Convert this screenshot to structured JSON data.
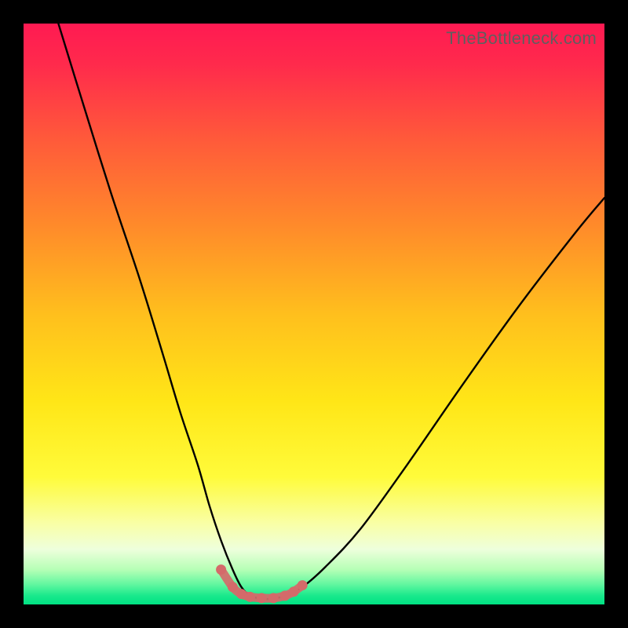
{
  "watermark": "TheBottleneck.com",
  "colors": {
    "frame": "#000000",
    "gradient_stops": [
      {
        "offset": 0.0,
        "color": "#ff1a52"
      },
      {
        "offset": 0.07,
        "color": "#ff2a4c"
      },
      {
        "offset": 0.2,
        "color": "#ff5a3a"
      },
      {
        "offset": 0.35,
        "color": "#ff8b2a"
      },
      {
        "offset": 0.5,
        "color": "#ffbf1d"
      },
      {
        "offset": 0.65,
        "color": "#ffe617"
      },
      {
        "offset": 0.78,
        "color": "#fffb3a"
      },
      {
        "offset": 0.86,
        "color": "#f9ffa5"
      },
      {
        "offset": 0.905,
        "color": "#eeffdc"
      },
      {
        "offset": 0.94,
        "color": "#b6ffb6"
      },
      {
        "offset": 0.965,
        "color": "#63f7a0"
      },
      {
        "offset": 0.985,
        "color": "#19e98c"
      },
      {
        "offset": 1.0,
        "color": "#00e183"
      }
    ],
    "curve": "#000000",
    "marker": "#d46a6a"
  },
  "chart_data": {
    "type": "line",
    "title": "",
    "xlabel": "",
    "ylabel": "",
    "xlim": [
      0,
      100
    ],
    "ylim": [
      0,
      100
    ],
    "grid": false,
    "series": [
      {
        "name": "bottleneck-curve",
        "x": [
          6,
          10,
          15,
          20,
          24,
          27,
          30,
          32,
          34,
          36,
          37.5,
          39,
          41,
          43,
          45,
          48,
          52,
          58,
          66,
          75,
          85,
          95,
          100
        ],
        "values": [
          100,
          87,
          71,
          56,
          43,
          33,
          24,
          17,
          11,
          6,
          3,
          1.5,
          1,
          1,
          1.5,
          3,
          6.5,
          13,
          24,
          37,
          51,
          64,
          70
        ]
      }
    ],
    "markers": {
      "name": "bottom-highlight",
      "x": [
        34,
        36,
        37.5,
        39,
        41,
        43,
        45,
        46.5,
        48
      ],
      "values": [
        6,
        3,
        1.8,
        1.3,
        1.1,
        1.1,
        1.5,
        2.2,
        3.3
      ]
    }
  }
}
